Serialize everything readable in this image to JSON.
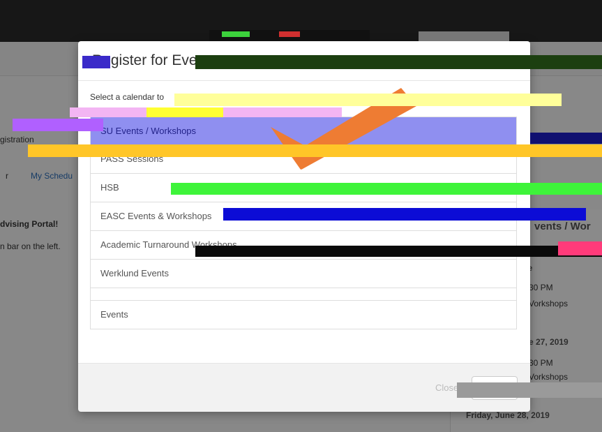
{
  "background": {
    "left_labels": [
      {
        "text": "gistration",
        "bold": false,
        "link": false
      },
      {
        "text": "r",
        "bold": false,
        "link": false
      },
      {
        "text": "My Schedu",
        "bold": false,
        "link": true
      },
      {
        "text": "dvising Portal!",
        "bold": true,
        "link": false
      },
      {
        "text": "n bar on the left.",
        "bold": false,
        "link": false
      }
    ],
    "right_panel": {
      "heading": "vents / Wor",
      "items": [
        {
          "text": "une",
          "type": "date"
        },
        {
          "text": "30 PM",
          "type": "time"
        },
        {
          "text": "Vorkshops",
          "type": "text"
        },
        {
          "text": "e 27, 2019",
          "type": "date"
        },
        {
          "text": "30 PM",
          "type": "time"
        },
        {
          "text": "Vorkshops",
          "type": "text"
        },
        {
          "text": "Friday, June 28, 2019",
          "type": "date"
        }
      ]
    }
  },
  "modal": {
    "title": "Register for Event",
    "close_x": "×",
    "prompt": "Select a calendar to",
    "calendars": [
      {
        "label": "SU Events / Workshops",
        "active": true
      },
      {
        "label": "PASS Sessions",
        "active": false
      },
      {
        "label": "HSB",
        "active": false
      },
      {
        "label": "EASC Events & Workshops",
        "active": false
      },
      {
        "label": "Academic Turnaround Workshops",
        "active": false
      },
      {
        "label": "Werklund Events",
        "active": false
      },
      {
        "label": "",
        "active": false
      },
      {
        "label": "Events",
        "active": false
      }
    ],
    "footer": {
      "close_link_label": "Close",
      "close_button_label": "Close"
    }
  },
  "colors": {
    "overlay": "rgba(0,0,0,0.45)",
    "arrow": "#ee7c33",
    "active_item_bg": "#8f8ff0"
  },
  "icons": {
    "close": "close-icon",
    "arrow": "arrow-annotation-icon"
  }
}
